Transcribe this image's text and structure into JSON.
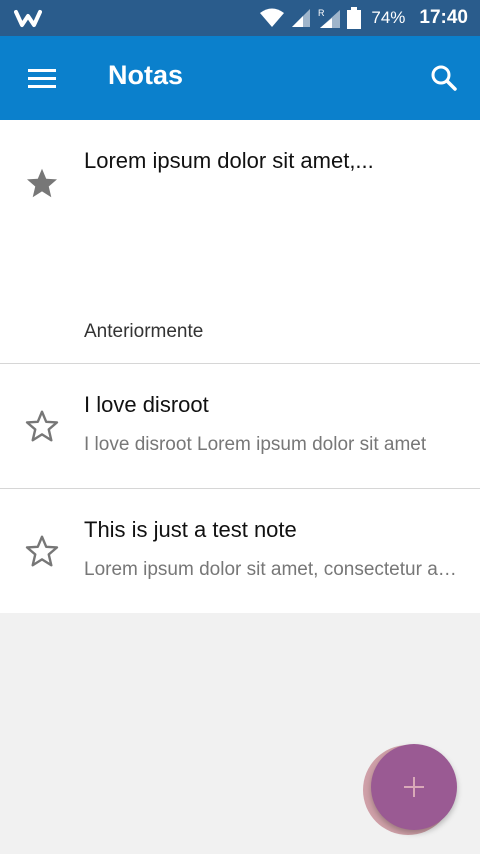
{
  "status_bar": {
    "battery_percent": "74%",
    "time": "17:40"
  },
  "app_bar": {
    "title": "Notas"
  },
  "notes": [
    {
      "title": "Lorem ipsum dolor sit amet,...",
      "preview": "",
      "starred": true
    },
    {
      "title": "I love disroot",
      "preview": "I love disroot Lorem ipsum dolor sit amet",
      "starred": false
    },
    {
      "title": "This is just a test note",
      "preview": "Lorem ipsum dolor sit amet, consectetur adipiscing",
      "starred": false
    }
  ],
  "section_label": "Anteriormente",
  "colors": {
    "status_bar": "#2a5c8c",
    "app_bar": "#0b80cc",
    "fab": "#9a5a93",
    "background": "#f1f1f1"
  },
  "icons": {
    "menu": "hamburger-menu-icon",
    "search": "search-icon",
    "star_filled": "star-filled-icon",
    "star_outline": "star-outline-icon",
    "add": "plus-icon"
  }
}
